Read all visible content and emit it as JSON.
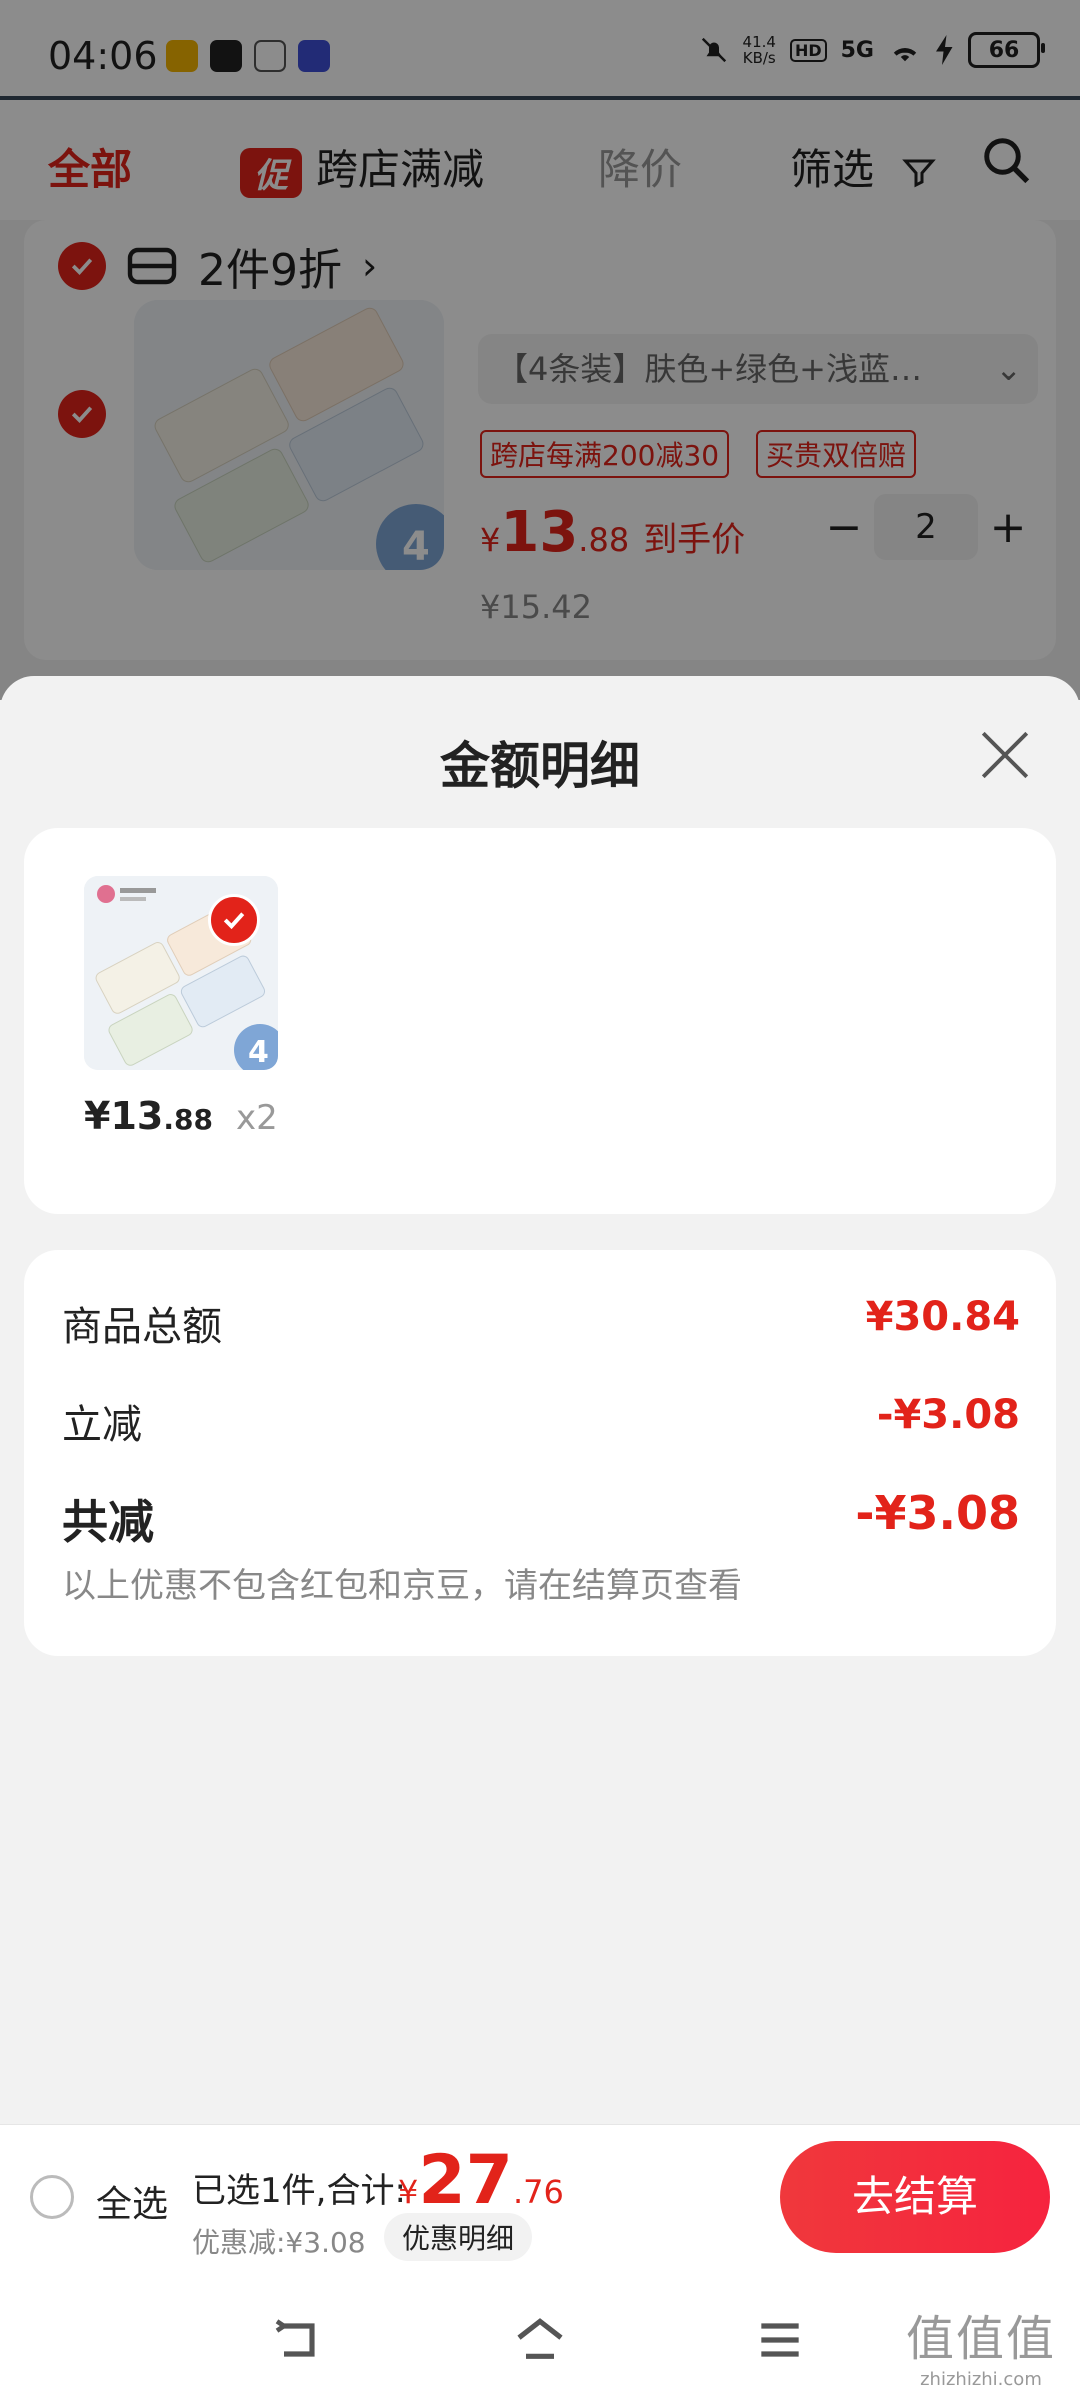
{
  "status_bar": {
    "time": "04:06",
    "net_speed_value": "41.4",
    "net_speed_unit": "KB/s",
    "hd": "HD",
    "network": "5G",
    "battery": "66",
    "app_icons": [
      "game-app-icon",
      "qq-app-icon",
      "wechat-app-icon",
      "tieba-app-icon"
    ]
  },
  "tabs": {
    "all": "全部",
    "promo_badge": "促",
    "cross_store": "跨店满减",
    "price_drop": "降价",
    "filter": "筛选"
  },
  "cart_item": {
    "bundle_label": "2件9折",
    "spec": "【4条装】肤色+绿色+浅蓝…",
    "tags": [
      "跨店每满200减30",
      "买贵双倍赔"
    ],
    "price_currency": "¥",
    "price_int": "13",
    "price_dec": ".88",
    "price_label": "到手价",
    "original_price": "¥15.42",
    "quantity": "2",
    "minus": "−",
    "plus": "+",
    "image_badge": "4"
  },
  "sheet": {
    "title": "金额明细",
    "item": {
      "price_int": "¥13",
      "price_dec": ".88",
      "qty": "x2",
      "badge": "4"
    },
    "summary": {
      "goods_total_label": "商品总额",
      "goods_total_value": "¥30.84",
      "instant_discount_label": "立减",
      "instant_discount_value": "-¥3.08",
      "total_discount_label": "共减",
      "total_discount_value": "-¥3.08",
      "note": "以上优惠不包含红包和京豆，请在结算页查看"
    }
  },
  "footer": {
    "select_all": "全选",
    "selected_text": "已选1件,合计:",
    "total_currency": "¥",
    "total_int": "27",
    "total_dec": ".76",
    "discount_line": "优惠减:¥3.08",
    "detail_button": "优惠明细",
    "checkout": "去结算"
  },
  "watermark": {
    "big": "值值值",
    "small": "zhizhizhi.com"
  },
  "colors": {
    "accent": "#e2231a",
    "checkout": "#f52d3c"
  }
}
